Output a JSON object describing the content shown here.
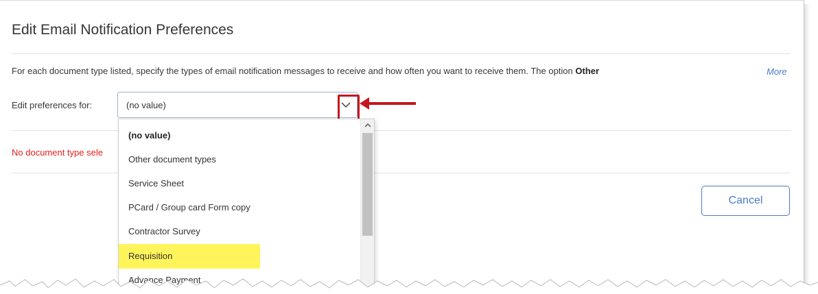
{
  "page": {
    "title": "Edit Email Notification Preferences",
    "description_prefix": "For each document type listed, specify the types of email notification messages to receive and how often you want to receive them. The option ",
    "description_bold": "Other",
    "more_link": "More"
  },
  "preferences": {
    "label": "Edit preferences for:",
    "selected_value": "(no value)",
    "options": [
      "(no value)",
      "Other document types",
      "Service Sheet",
      "PCard / Group card Form copy",
      "Contractor Survey",
      "Requisition",
      "Advance Payment"
    ],
    "highlighted_option": "Requisition"
  },
  "status": {
    "error_text": "No document type sele"
  },
  "actions": {
    "cancel_label": "Cancel"
  },
  "colors": {
    "annotation_red": "#c4161c",
    "link_blue": "#4a7bc8",
    "error_red": "#e0201b",
    "highlight_yellow": "#fff55a"
  }
}
